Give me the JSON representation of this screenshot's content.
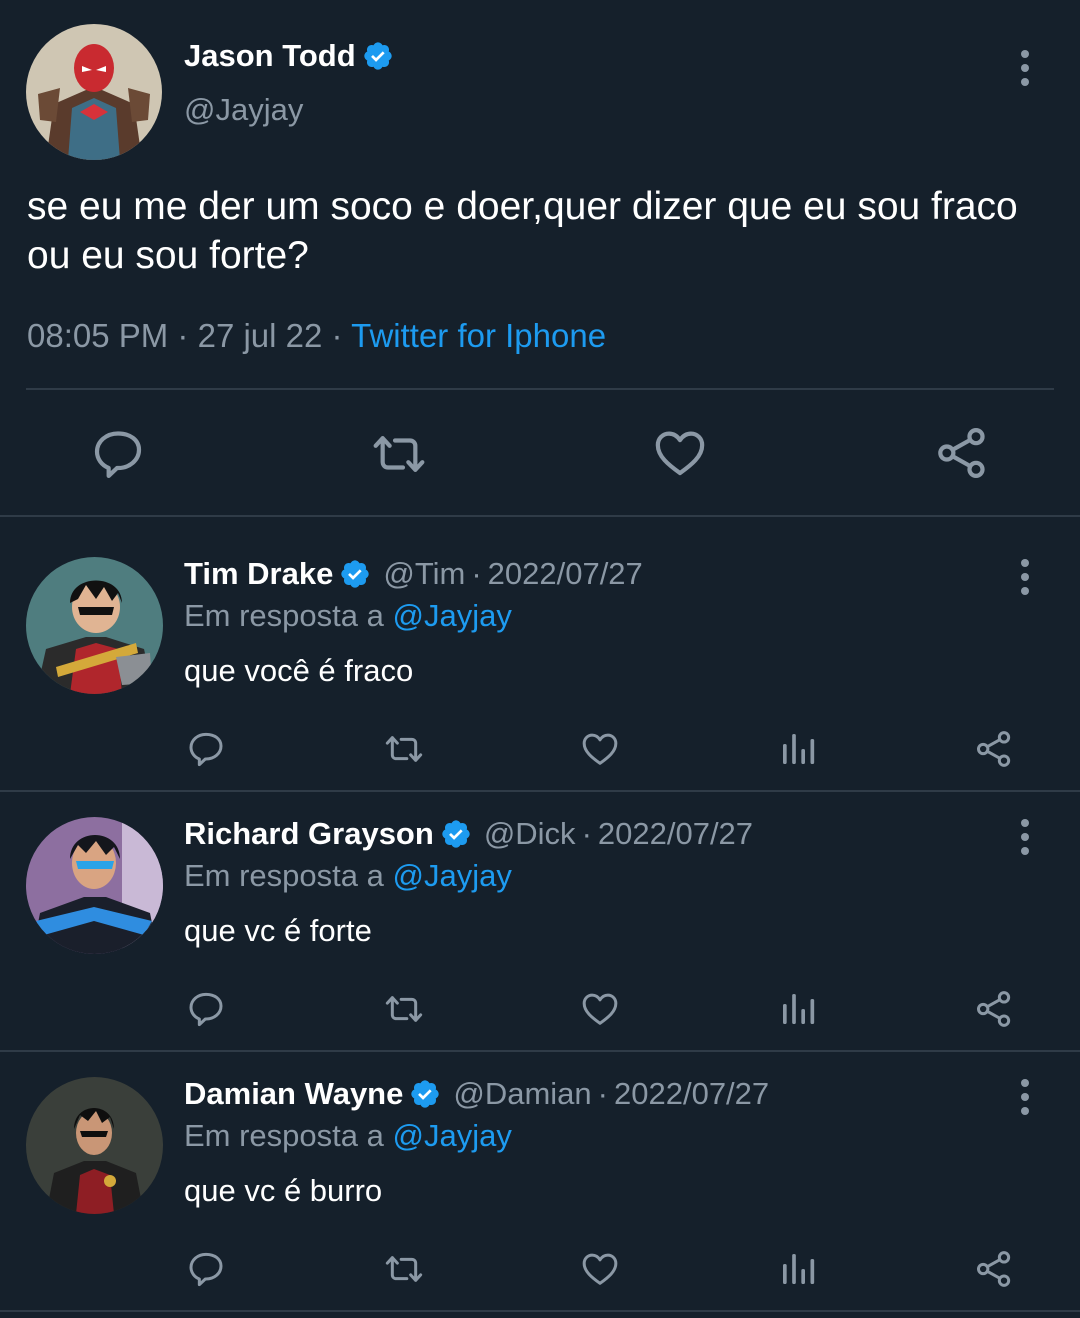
{
  "main_tweet": {
    "author_name": "Jason Todd",
    "author_handle": "@Jayjay",
    "verified": true,
    "text": "se eu me der um soco e doer,quer dizer que eu sou fraco ou eu sou forte?",
    "time": "08:05 PM",
    "date": "27 jul 22",
    "separator": "·",
    "source": "Twitter for Iphone",
    "actions": [
      "reply-icon",
      "retweet-icon",
      "like-icon",
      "share-icon"
    ]
  },
  "replies": [
    {
      "author_name": "Tim Drake",
      "author_handle": "@Tim",
      "separator": "·",
      "date": "2022/07/27",
      "verified": true,
      "reply_to_label": "Em resposta a ",
      "reply_to_handle": "@Jayjay",
      "text": "que você é fraco"
    },
    {
      "author_name": "Richard Grayson",
      "author_handle": "@Dick",
      "separator": "·",
      "date": "2022/07/27",
      "verified": true,
      "reply_to_label": "Em resposta a ",
      "reply_to_handle": "@Jayjay",
      "text": "que vc é forte"
    },
    {
      "author_name": "Damian Wayne",
      "author_handle": "@Damian",
      "separator": "·",
      "date": "2022/07/27",
      "verified": true,
      "reply_to_label": "Em resposta a ",
      "reply_to_handle": "@Jayjay",
      "text": "que vc é burro"
    }
  ],
  "colors": {
    "background": "#15202b",
    "text": "#ffffff",
    "secondary": "#8b98a5",
    "accent": "#1d9bf0",
    "divider": "#2f3b47"
  }
}
